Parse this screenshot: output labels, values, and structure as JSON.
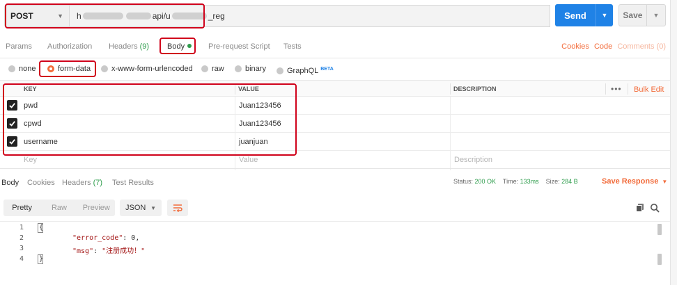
{
  "request": {
    "method": "POST",
    "url_prefix": "h",
    "url_mid": "api/u",
    "url_suffix": "_reg",
    "send_label": "Send",
    "save_label": "Save"
  },
  "request_tabs": {
    "params": "Params",
    "authorization": "Authorization",
    "headers": "Headers",
    "headers_count": "(9)",
    "body": "Body",
    "prerequest": "Pre-request Script",
    "tests": "Tests",
    "cookies": "Cookies",
    "code": "Code",
    "comments": "Comments (0)"
  },
  "body_types": {
    "none": "none",
    "form_data": "form-data",
    "urlencoded": "x-www-form-urlencoded",
    "raw": "raw",
    "binary": "binary",
    "graphql": "GraphQL",
    "beta": "BETA",
    "selected": "form-data"
  },
  "params_table": {
    "headers": {
      "key": "KEY",
      "value": "VALUE",
      "description": "DESCRIPTION",
      "more": "•••",
      "bulk_edit": "Bulk Edit"
    },
    "rows": [
      {
        "checked": true,
        "key": "pwd",
        "value": "Juan123456",
        "description": ""
      },
      {
        "checked": true,
        "key": "cpwd",
        "value": "Juan123456",
        "description": ""
      },
      {
        "checked": true,
        "key": "username",
        "value": "juanjuan",
        "description": ""
      }
    ],
    "placeholders": {
      "key": "Key",
      "value": "Value",
      "description": "Description"
    }
  },
  "response_tabs": {
    "body": "Body",
    "cookies": "Cookies",
    "headers": "Headers",
    "headers_count": "(7)",
    "test_results": "Test Results",
    "status_label": "Status:",
    "status_value": "200 OK",
    "time_label": "Time:",
    "time_value": "133ms",
    "size_label": "Size:",
    "size_value": "284 B",
    "save_response": "Save Response"
  },
  "response_toolbar": {
    "pretty": "Pretty",
    "raw": "Raw",
    "preview": "Preview",
    "format": "JSON"
  },
  "response_body": {
    "line_numbers": [
      "1",
      "2",
      "3",
      "4"
    ],
    "open_brace": "{",
    "error_code_key": "\"error_code\"",
    "error_code_value": "0",
    "msg_key": "\"msg\"",
    "msg_value": "\"注册成功！\"",
    "close_brace": "}"
  },
  "colors": {
    "accent_orange": "#f26b3a",
    "send_blue": "#1f82e6",
    "status_green": "#2d9c4b",
    "highlight_red": "#d0021b"
  }
}
